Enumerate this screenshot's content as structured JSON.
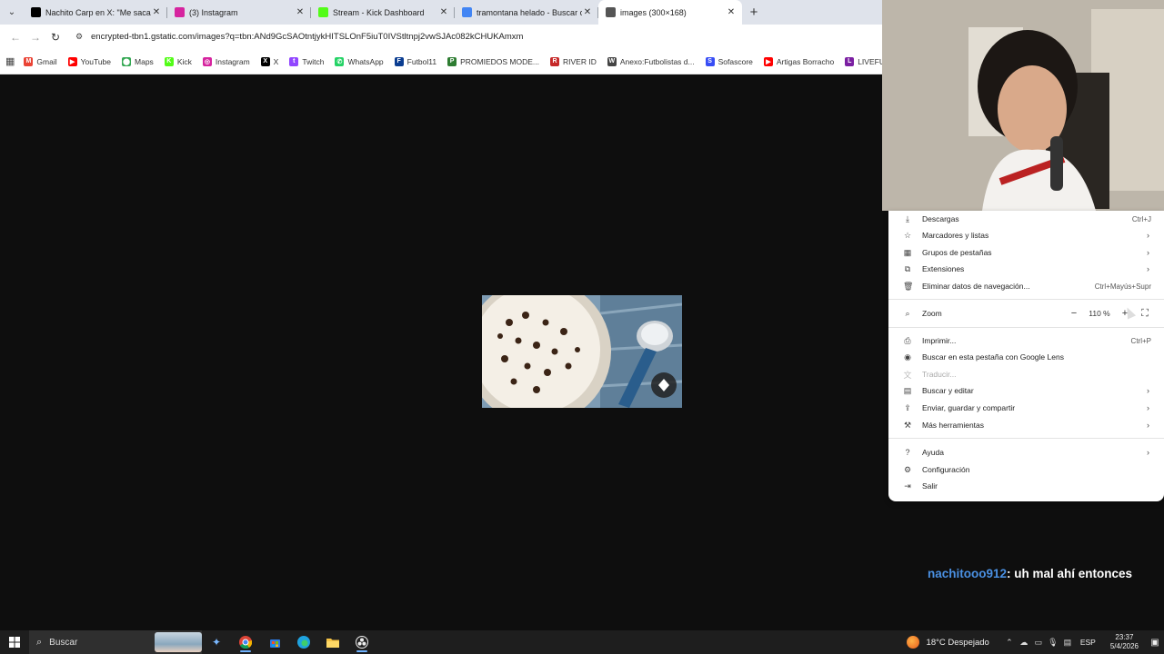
{
  "browser": {
    "tabs": [
      {
        "title": "Nachito Carp en X: \"Me saca de",
        "favicon": "x-logo",
        "color": "#000000",
        "active": false
      },
      {
        "title": "(3) Instagram",
        "favicon": "instagram-logo",
        "color": "#d6249f",
        "active": false
      },
      {
        "title": "Stream - Kick Dashboard",
        "favicon": "kick-logo",
        "color": "#53fc18",
        "active": false
      },
      {
        "title": "tramontana helado - Buscar con",
        "favicon": "google-logo",
        "color": "#4285f4",
        "active": false
      },
      {
        "title": "images (300×168)",
        "favicon": "globe-icon",
        "color": "#555555",
        "active": true
      }
    ],
    "url": "encrypted-tbn1.gstatic.com/images?q=tbn:ANd9GcSAOtntjykHITSLOnF5iuT0IVStltnpj2vwSJAc082kCHUKAmxm",
    "bookmarks": [
      {
        "label": "Gmail",
        "color": "#ea4335",
        "glyph": "M"
      },
      {
        "label": "YouTube",
        "color": "#ff0000",
        "glyph": "▶"
      },
      {
        "label": "Maps",
        "color": "#34a853",
        "glyph": "⬤"
      },
      {
        "label": "Kick",
        "color": "#53fc18",
        "glyph": "K"
      },
      {
        "label": "Instagram",
        "color": "#d6249f",
        "glyph": "◎"
      },
      {
        "label": "X",
        "color": "#000000",
        "glyph": "X"
      },
      {
        "label": "Twitch",
        "color": "#9146ff",
        "glyph": "t"
      },
      {
        "label": "WhatsApp",
        "color": "#25d366",
        "glyph": "✆"
      },
      {
        "label": "Futbol11",
        "color": "#0b3d91",
        "glyph": "F"
      },
      {
        "label": "PROMIEDOS MODE...",
        "color": "#2e7d32",
        "glyph": "P"
      },
      {
        "label": "RIVER ID",
        "color": "#c62828",
        "glyph": "R"
      },
      {
        "label": "Anexo:Futbolistas d...",
        "color": "#444444",
        "glyph": "W"
      },
      {
        "label": "Sofascore",
        "color": "#374df5",
        "glyph": "S"
      },
      {
        "label": "Artigas Borracho",
        "color": "#ff0000",
        "glyph": "▶"
      },
      {
        "label": "LIVEFUTBOL",
        "color": "#7b1fa2",
        "glyph": "L"
      }
    ]
  },
  "menu": {
    "items": [
      {
        "label": "Descargas",
        "icon": "download-icon",
        "glyph": "⤓",
        "shortcut": "Ctrl+J",
        "arrow": false,
        "disabled": false
      },
      {
        "label": "Marcadores y listas",
        "icon": "star-icon",
        "glyph": "☆",
        "shortcut": "",
        "arrow": true,
        "disabled": false
      },
      {
        "label": "Grupos de pestañas",
        "icon": "tab-groups-icon",
        "glyph": "▦",
        "shortcut": "",
        "arrow": true,
        "disabled": false
      },
      {
        "label": "Extensiones",
        "icon": "puzzle-icon",
        "glyph": "⧉",
        "shortcut": "",
        "arrow": true,
        "disabled": false
      },
      {
        "label": "Eliminar datos de navegación...",
        "icon": "trash-icon",
        "glyph": "🗑",
        "shortcut": "Ctrl+Mayús+Supr",
        "arrow": false,
        "disabled": false
      },
      {
        "label": "Imprimir...",
        "icon": "printer-icon",
        "glyph": "⎙",
        "shortcut": "Ctrl+P",
        "arrow": false,
        "disabled": false
      },
      {
        "label": "Buscar en esta pestaña con Google Lens",
        "icon": "lens-icon",
        "glyph": "◉",
        "shortcut": "",
        "arrow": false,
        "disabled": false
      },
      {
        "label": "Traducir...",
        "icon": "translate-icon",
        "glyph": "文",
        "shortcut": "",
        "arrow": false,
        "disabled": true
      },
      {
        "label": "Buscar y editar",
        "icon": "document-search-icon",
        "glyph": "▤",
        "shortcut": "",
        "arrow": true,
        "disabled": false
      },
      {
        "label": "Enviar, guardar y compartir",
        "icon": "share-icon",
        "glyph": "⇪",
        "shortcut": "",
        "arrow": true,
        "disabled": false
      },
      {
        "label": "Más herramientas",
        "icon": "toolbox-icon",
        "glyph": "⚒",
        "shortcut": "",
        "arrow": true,
        "disabled": false
      },
      {
        "label": "Ayuda",
        "icon": "help-icon",
        "glyph": "?",
        "shortcut": "",
        "arrow": true,
        "disabled": false
      },
      {
        "label": "Configuración",
        "icon": "gear-icon",
        "glyph": "⚙",
        "shortcut": "",
        "arrow": false,
        "disabled": false
      },
      {
        "label": "Salir",
        "icon": "exit-icon",
        "glyph": "⇥",
        "shortcut": "",
        "arrow": false,
        "disabled": false
      }
    ],
    "zoom": {
      "label": "Zoom",
      "value": "110 %",
      "minus": "−",
      "plus": "+",
      "fullscreen": "⛶"
    }
  },
  "chat": {
    "user": "nachitooo912",
    "message": ": uh mal ahí entonces"
  },
  "taskbar": {
    "search_placeholder": "Buscar",
    "weather": "18°C Despejado",
    "lang": "ESP",
    "time": "23:37",
    "date": "5/4/2026"
  }
}
